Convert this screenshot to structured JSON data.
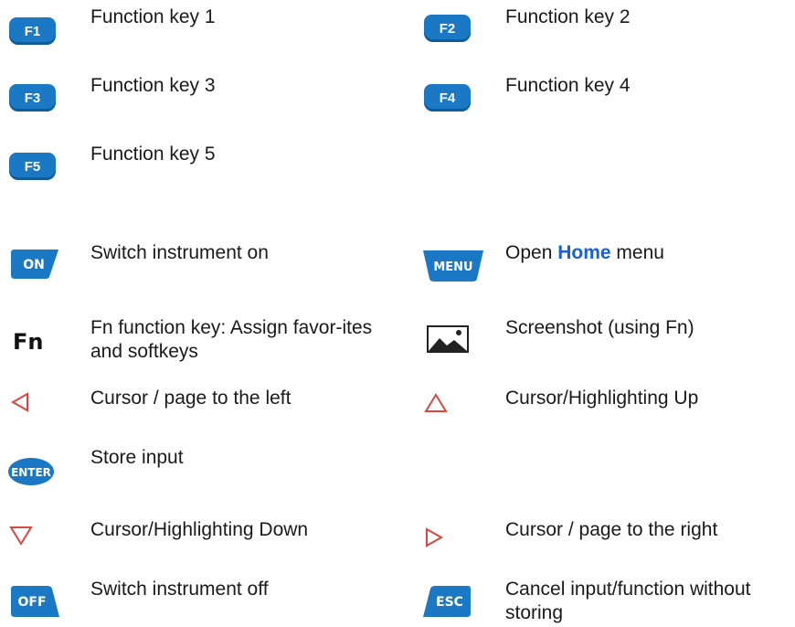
{
  "keys": [
    {
      "id": "f1",
      "key_label": "F1",
      "desc": "Function key 1"
    },
    {
      "id": "f2",
      "key_label": "F2",
      "desc": "Function key 2"
    },
    {
      "id": "f3",
      "key_label": "F3",
      "desc": "Function key 3"
    },
    {
      "id": "f4",
      "key_label": "F4",
      "desc": "Function key 4"
    },
    {
      "id": "f5",
      "key_label": "F5",
      "desc": "Function key 5"
    },
    {
      "id": "on",
      "key_label": "ON",
      "desc": "Switch instrument on"
    },
    {
      "id": "menu",
      "key_label": "MENU",
      "desc_prefix": "Open ",
      "desc_link": "Home",
      "desc_suffix": " menu"
    },
    {
      "id": "fn",
      "key_label": "Fn",
      "desc": "Fn function key: Assign favor-ites and softkeys"
    },
    {
      "id": "screenshot",
      "icon": "image-icon",
      "desc": "Screenshot (using Fn)"
    },
    {
      "id": "left",
      "icon": "triangle-left-icon",
      "desc": "Cursor / page to the left"
    },
    {
      "id": "up",
      "icon": "triangle-up-icon",
      "desc": "Cursor/Highlighting Up"
    },
    {
      "id": "enter",
      "key_label": "ENTER",
      "desc": "Store input"
    },
    {
      "id": "down",
      "icon": "triangle-down-icon",
      "desc": "Cursor/Highlighting Down"
    },
    {
      "id": "right",
      "icon": "triangle-right-icon",
      "desc": "Cursor / page to the right"
    },
    {
      "id": "off",
      "key_label": "OFF",
      "desc": "Switch instrument off"
    },
    {
      "id": "esc",
      "key_label": "ESC",
      "desc": "Cancel input/function without storing"
    }
  ],
  "colors": {
    "key_blue": "#1a78c4",
    "arrow_red": "#d9473f",
    "link_blue": "#1a5fd6",
    "text": "#1a1a1a"
  }
}
